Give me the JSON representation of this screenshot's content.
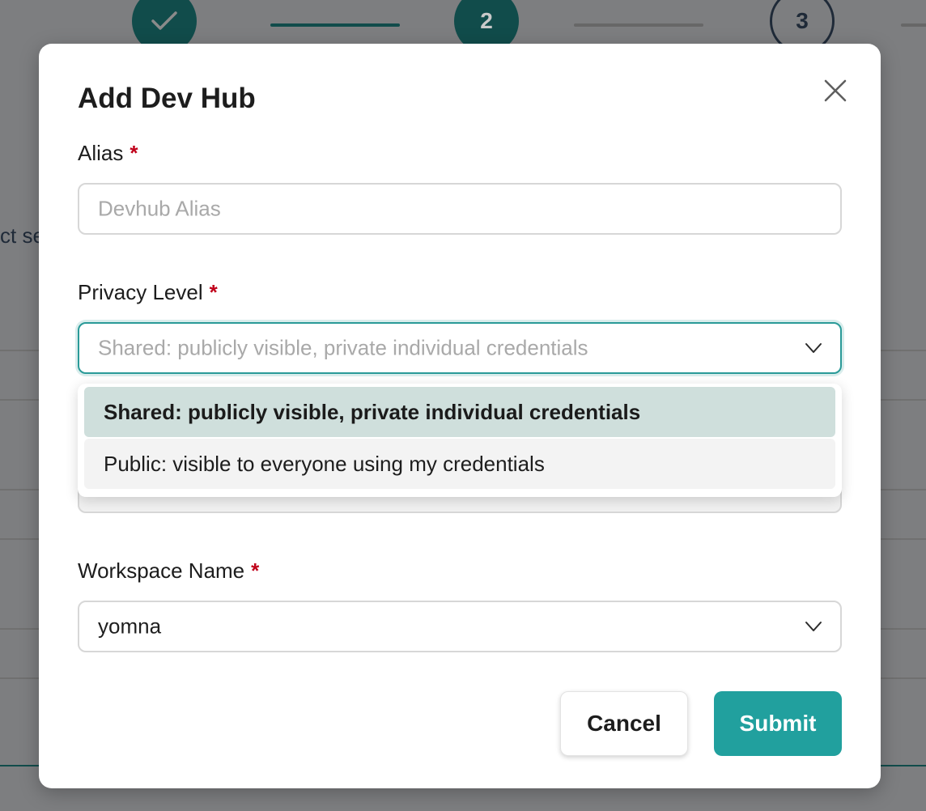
{
  "background": {
    "steps": [
      {
        "state": "done",
        "icon": "check-icon"
      },
      {
        "state": "active",
        "label": "2"
      },
      {
        "state": "pending",
        "label": "3"
      }
    ],
    "partial_text": "ct se"
  },
  "modal": {
    "title": "Add Dev Hub",
    "close_icon": "close-icon",
    "alias": {
      "label": "Alias",
      "required_mark": "*",
      "value": "",
      "placeholder": "Devhub Alias"
    },
    "privacy": {
      "label": "Privacy Level",
      "required_mark": "*",
      "placeholder": "Shared: publicly visible, private individual credentials",
      "options": [
        {
          "label": "Shared: publicly visible, private individual credentials",
          "selected": true
        },
        {
          "label": "Public: visible to everyone using my credentials",
          "selected": false
        }
      ]
    },
    "workspace": {
      "label": "Workspace Name",
      "required_mark": "*",
      "value": "yomna"
    },
    "buttons": {
      "cancel": "Cancel",
      "submit": "Submit"
    }
  },
  "colors": {
    "accent": "#21a09e",
    "focus_border": "#2a9a98",
    "selected_option_bg": "#cfdfdc",
    "required": "#c0001a"
  }
}
